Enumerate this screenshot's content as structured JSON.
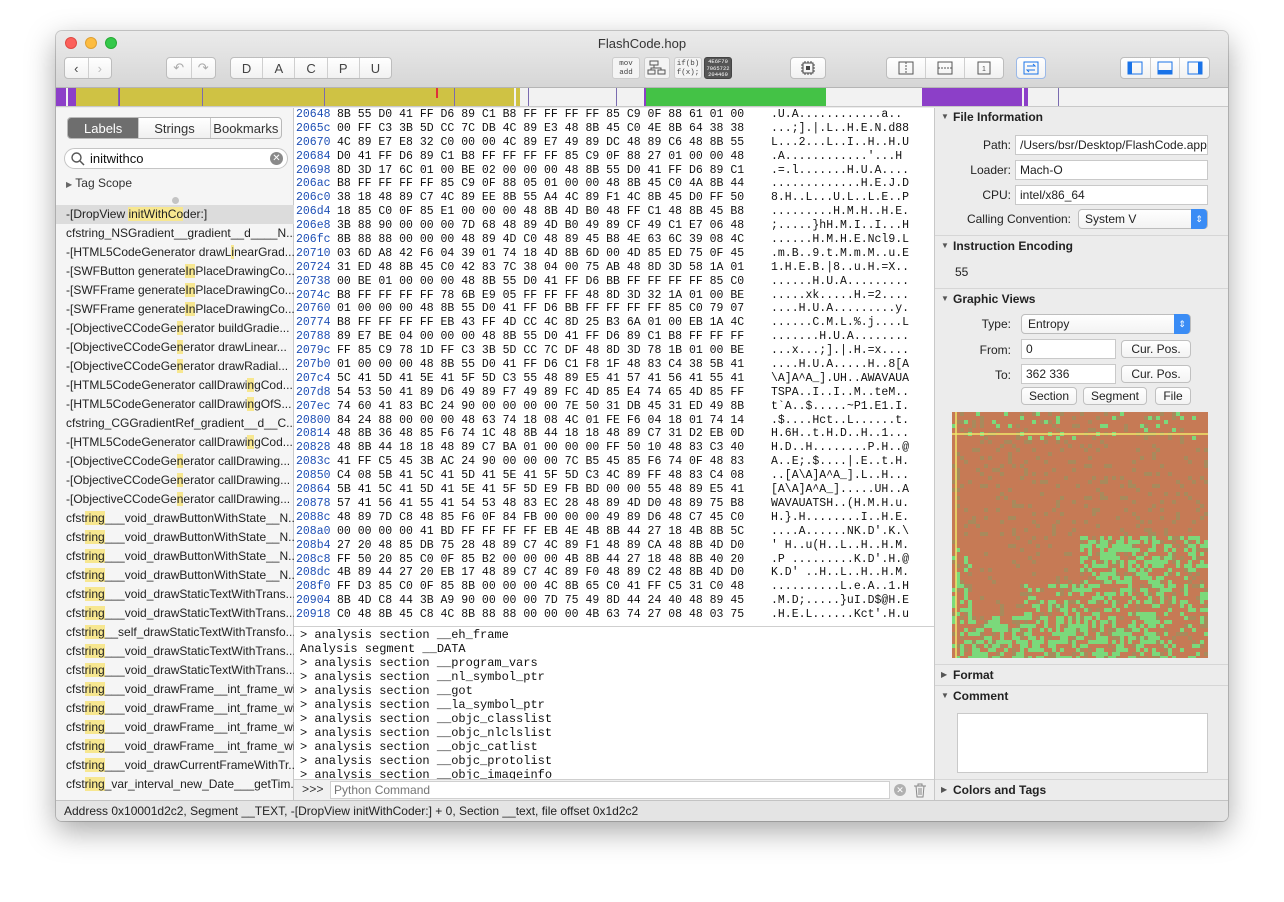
{
  "window": {
    "title": "FlashCode.hop"
  },
  "toolbar": {
    "mode_buttons": [
      "D",
      "A",
      "C",
      "P",
      "U"
    ],
    "asm_icon_text": [
      "mov",
      "add"
    ],
    "pseudo_icon_text": [
      "if(b)",
      "f(x);"
    ],
    "hex_icon_text": [
      "4E6F70",
      "7065722",
      "204469"
    ]
  },
  "navbar_colors": {
    "code": "#cfc244",
    "procedure": "#8c3fc8",
    "data": "#44c246",
    "empty": "#f2f2f2",
    "cursor": "#e0303a"
  },
  "sidebar": {
    "tabs": [
      "Labels",
      "Strings",
      "Bookmarks"
    ],
    "active_tab": "Labels",
    "search_value": "initwithco",
    "tag_scope": "Tag Scope",
    "labels": [
      {
        "pre": "-[DropView ",
        "hl": "initWithCo",
        "post": "der:]"
      },
      {
        "pre": "cfstring_NSGradient__gradient__d",
        "hl": "",
        "post": "____N..."
      },
      {
        "pre": "-[HTML5CodeGenerator drawL",
        "hl": "i",
        "post": "nearGrad..."
      },
      {
        "pre": "-[SWFButton generate",
        "hl": "In",
        "post": "PlaceDrawingCo..."
      },
      {
        "pre": "-[SWFFrame generate",
        "hl": "In",
        "post": "PlaceDrawingCo..."
      },
      {
        "pre": "-[SWFFrame generate",
        "hl": "In",
        "post": "PlaceDrawingCo..."
      },
      {
        "pre": "-[ObjectiveCCodeGe",
        "hl": "n",
        "post": "erator buildGradie..."
      },
      {
        "pre": "-[ObjectiveCCodeGe",
        "hl": "n",
        "post": "erator drawLinear..."
      },
      {
        "pre": "-[ObjectiveCCodeGe",
        "hl": "n",
        "post": "erator drawRadial..."
      },
      {
        "pre": "-[HTML5CodeGenerator callDrawi",
        "hl": "n",
        "post": "gCod..."
      },
      {
        "pre": "-[HTML5CodeGenerator callDrawi",
        "hl": "n",
        "post": "gOfS..."
      },
      {
        "pre": "cfstring_CGGradientRef_gradient__d",
        "hl": "",
        "post": "__C..."
      },
      {
        "pre": "-[HTML5CodeGenerator callDrawi",
        "hl": "n",
        "post": "gCod..."
      },
      {
        "pre": "-[ObjectiveCCodeGe",
        "hl": "n",
        "post": "erator callDrawing..."
      },
      {
        "pre": "-[ObjectiveCCodeGe",
        "hl": "n",
        "post": "erator callDrawing..."
      },
      {
        "pre": "-[ObjectiveCCodeGe",
        "hl": "n",
        "post": "erator callDrawing..."
      },
      {
        "pre": "cfst",
        "hl": "ring",
        "post": "___void_drawButtonWithState__N..."
      },
      {
        "pre": "cfst",
        "hl": "ring",
        "post": "___void_drawButtonWithState__N..."
      },
      {
        "pre": "cfst",
        "hl": "ring",
        "post": "___void_drawButtonWithState__N..."
      },
      {
        "pre": "cfst",
        "hl": "ring",
        "post": "___void_drawButtonWithState__N..."
      },
      {
        "pre": "cfst",
        "hl": "ring",
        "post": "___void_drawStaticTextWithTrans..."
      },
      {
        "pre": "cfst",
        "hl": "ring",
        "post": "___void_drawStaticTextWithTrans..."
      },
      {
        "pre": "cfst",
        "hl": "ring",
        "post": "__self_drawStaticTextWithTransfo..."
      },
      {
        "pre": "cfst",
        "hl": "ring",
        "post": "___void_drawStaticTextWithTrans..."
      },
      {
        "pre": "cfst",
        "hl": "ring",
        "post": "___void_drawStaticTextWithTrans..."
      },
      {
        "pre": "cfst",
        "hl": "ring",
        "post": "___void_drawFrame__int_frame_wi..."
      },
      {
        "pre": "cfst",
        "hl": "ring",
        "post": "___void_drawFrame__int_frame_wi..."
      },
      {
        "pre": "cfst",
        "hl": "ring",
        "post": "___void_drawFrame__int_frame_wi..."
      },
      {
        "pre": "cfst",
        "hl": "ring",
        "post": "___void_drawFrame__int_frame_wi..."
      },
      {
        "pre": "cfst",
        "hl": "ring",
        "post": "___void_drawCurrentFrameWithTr..."
      },
      {
        "pre": "cfst",
        "hl": "ring",
        "post": "_var_interval_new_Date___getTim..."
      }
    ]
  },
  "hex": {
    "rows": [
      {
        "addr": "20648",
        "bytes": "8B 55 D0 41 FF D6 89 C1 B8 FF FF FF FF 85 C9 0F 88 61 01 00",
        "ascii": ".U.A............a.."
      },
      {
        "addr": "2065c",
        "bytes": "00 FF C3 3B 5D CC 7C DB 4C 89 E3 48 8B 45 C0 4E 8B 64 38 38",
        "ascii": "...;].|.L..H.E.N.d88"
      },
      {
        "addr": "20670",
        "bytes": "4C 89 E7 E8 32 C0 00 00 4C 89 E7 49 89 DC 48 89 C6 48 8B 55",
        "ascii": "L...2...L..I..H..H.U"
      },
      {
        "addr": "20684",
        "bytes": "D0 41 FF D6 89 C1 B8 FF FF FF FF 85 C9 0F 88 27 01 00 00 48",
        "ascii": ".A............'...H"
      },
      {
        "addr": "20698",
        "bytes": "8D 3D 17 6C 01 00 BE 02 00 00 00 48 8B 55 D0 41 FF D6 89 C1",
        "ascii": ".=.l.......H.U.A...."
      },
      {
        "addr": "206ac",
        "bytes": "B8 FF FF FF FF 85 C9 0F 88 05 01 00 00 48 8B 45 C0 4A 8B 44",
        "ascii": ".............H.E.J.D"
      },
      {
        "addr": "206c0",
        "bytes": "38 18 48 89 C7 4C 89 EE 8B 55 A4 4C 89 F1 4C 8B 45 D0 FF 50",
        "ascii": "8.H..L...U.L..L.E..P"
      },
      {
        "addr": "206d4",
        "bytes": "18 85 C0 0F 85 E1 00 00 00 48 8B 4D B0 48 FF C1 48 8B 45 B8",
        "ascii": ".........H.M.H..H.E."
      },
      {
        "addr": "206e8",
        "bytes": "3B 88 90 00 00 00 7D 68 48 89 4D B0 49 89 CF 49 C1 E7 06 48",
        "ascii": ";.....}hH.M.I..I...H"
      },
      {
        "addr": "206fc",
        "bytes": "8B 88 88 00 00 00 48 89 4D C0 48 89 45 B8 4E 63 6C 39 08 4C",
        "ascii": "......H.M.H.E.Ncl9.L"
      },
      {
        "addr": "20710",
        "bytes": "03 6D A8 42 F6 04 39 01 74 18 4D 8B 6D 00 4D 85 ED 75 0F 45",
        "ascii": ".m.B..9.t.M.m.M..u.E"
      },
      {
        "addr": "20724",
        "bytes": "31 ED 48 8B 45 C0 42 83 7C 38 04 00 75 AB 48 8D 3D 58 1A 01",
        "ascii": "1.H.E.B.|8..u.H.=X.."
      },
      {
        "addr": "20738",
        "bytes": "00 BE 01 00 00 00 48 8B 55 D0 41 FF D6 BB FF FF FF FF 85 C0",
        "ascii": "......H.U.A........."
      },
      {
        "addr": "2074c",
        "bytes": "B8 FF FF FF FF 78 6B E9 05 FF FF FF 48 8D 3D 32 1A 01 00 BE",
        "ascii": ".....xk.....H.=2...."
      },
      {
        "addr": "20760",
        "bytes": "01 00 00 00 48 8B 55 D0 41 FF D6 BB FF FF FF FF 85 C0 79 07",
        "ascii": "....H.U.A.........y."
      },
      {
        "addr": "20774",
        "bytes": "B8 FF FF FF FF EB 43 FF 4D CC 4C 8D 25 B3 6A 01 00 EB 1A 4C",
        "ascii": "......C.M.L.%.j....L"
      },
      {
        "addr": "20788",
        "bytes": "89 E7 BE 04 00 00 00 48 8B 55 D0 41 FF D6 89 C1 B8 FF FF FF",
        "ascii": ".......H.U.A........"
      },
      {
        "addr": "2079c",
        "bytes": "FF 85 C9 78 1D FF C3 3B 5D CC 7C DF 48 8D 3D 78 1B 01 00 BE",
        "ascii": "...x...;].|.H.=x...."
      },
      {
        "addr": "207b0",
        "bytes": "01 00 00 00 48 8B 55 D0 41 FF D6 C1 F8 1F 48 83 C4 38 5B 41",
        "ascii": "....H.U.A.....H..8[A"
      },
      {
        "addr": "207c4",
        "bytes": "5C 41 5D 41 5E 41 5F 5D C3 55 48 89 E5 41 57 41 56 41 55 41",
        "ascii": "\\A]A^A_].UH..AWAVAUA"
      },
      {
        "addr": "207d8",
        "bytes": "54 53 50 41 89 D6 49 89 F7 49 89 FC 4D 85 E4 74 65 4D 85 FF",
        "ascii": "TSPA..I..I..M..teM.."
      },
      {
        "addr": "207ec",
        "bytes": "74 60 41 83 BC 24 90 00 00 00 00 7E 50 31 DB 45 31 ED 49 8B",
        "ascii": "t`A..$.....~P1.E1.I."
      },
      {
        "addr": "20800",
        "bytes": "84 24 88 00 00 00 48 63 74 18 08 4C 01 FE F6 04 18 01 74 14",
        "ascii": ".$....Hct..L......t."
      },
      {
        "addr": "20814",
        "bytes": "48 8B 36 48 85 F6 74 1C 48 8B 44 18 18 48 89 C7 31 D2 EB 0D",
        "ascii": "H.6H..t.H.D..H..1..."
      },
      {
        "addr": "20828",
        "bytes": "48 8B 44 18 18 48 89 C7 BA 01 00 00 00 FF 50 10 48 83 C3 40",
        "ascii": "H.D..H........P.H..@"
      },
      {
        "addr": "2083c",
        "bytes": "41 FF C5 45 3B AC 24 90 00 00 00 7C B5 45 85 F6 74 0F 48 83",
        "ascii": "A..E;.$....|.E..t.H."
      },
      {
        "addr": "20850",
        "bytes": "C4 08 5B 41 5C 41 5D 41 5E 41 5F 5D C3 4C 89 FF 48 83 C4 08",
        "ascii": "..[A\\A]A^A_].L..H..."
      },
      {
        "addr": "20864",
        "bytes": "5B 41 5C 41 5D 41 5E 41 5F 5D E9 FB BD 00 00 55 48 89 E5 41",
        "ascii": "[A\\A]A^A_].....UH..A"
      },
      {
        "addr": "20878",
        "bytes": "57 41 56 41 55 41 54 53 48 83 EC 28 48 89 4D D0 48 89 75 B8",
        "ascii": "WAVAUATSH..(H.M.H.u."
      },
      {
        "addr": "2088c",
        "bytes": "48 89 7D C8 48 85 F6 0F 84 FB 00 00 00 49 89 D6 48 C7 45 C0",
        "ascii": "H.}.H........I..H.E."
      },
      {
        "addr": "208a0",
        "bytes": "00 00 00 00 41 BD FF FF FF FF EB 4E 4B 8B 44 27 18 4B 8B 5C",
        "ascii": "....A......NK.D'.K.\\"
      },
      {
        "addr": "208b4",
        "bytes": "27 20 48 85 DB 75 28 48 89 C7 4C 89 F1 48 89 CA 48 8B 4D D0",
        "ascii": "' H..u(H..L..H..H.M."
      },
      {
        "addr": "208c8",
        "bytes": "FF 50 20 85 C0 0F 85 B2 00 00 00 4B 8B 44 27 18 48 8B 40 20",
        "ascii": ".P .........K.D'.H.@ "
      },
      {
        "addr": "208dc",
        "bytes": "4B 89 44 27 20 EB 17 48 89 C7 4C 89 F0 48 89 C2 48 8B 4D D0",
        "ascii": "K.D' ..H..L..H..H.M."
      },
      {
        "addr": "208f0",
        "bytes": "FF D3 85 C0 0F 85 8B 00 00 00 4C 8B 65 C0 41 FF C5 31 C0 48",
        "ascii": "..........L.e.A..1.H"
      },
      {
        "addr": "20904",
        "bytes": "8B 4D C8 44 3B A9 90 00 00 00 7D 75 49 8D 44 24 40 48 89 45",
        "ascii": ".M.D;.....}uI.D$@H.E"
      },
      {
        "addr": "20918",
        "bytes": "C0 48 8B 45 C8 4C 8B 88 88 00 00 00 4B 63 74 27 08 48 03 75",
        "ascii": ".H.E.L......Kct'.H.u"
      }
    ]
  },
  "console": {
    "lines": [
      "> analysis section __eh_frame",
      "Analysis segment __DATA",
      "> analysis section __program_vars",
      "> analysis section __nl_symbol_ptr",
      "> analysis section __got",
      "> analysis section __la_symbol_ptr",
      "> analysis section __objc_classlist",
      "> analysis section __objc_nlclslist",
      "> analysis section __objc_catlist",
      "> analysis section __objc_protolist",
      "> analysis section __objc_imageinfo"
    ],
    "prompt": ">>>",
    "placeholder": "Python Command"
  },
  "status_bar": {
    "text": "Address 0x10001d2c2, Segment __TEXT, -[DropView initWithCoder:] + 0, Section __text, file offset 0x1d2c2"
  },
  "inspector": {
    "file_info": {
      "header": "File Information",
      "path_label": "Path:",
      "path": "/Users/bsr/Desktop/FlashCode.app/",
      "loader_label": "Loader:",
      "loader": "Mach-O",
      "cpu_label": "CPU:",
      "cpu": "intel/x86_64",
      "calling_label": "Calling Convention:",
      "calling": "System V"
    },
    "instruction_encoding": {
      "header": "Instruction Encoding",
      "value": "55"
    },
    "graphic_views": {
      "header": "Graphic Views",
      "type_label": "Type:",
      "type": "Entropy",
      "from_label": "From:",
      "from": "0",
      "to_label": "To:",
      "to": "362 336",
      "cur_pos": "Cur. Pos.",
      "section_btn": "Section",
      "segment_btn": "Segment",
      "file_btn": "File",
      "entropy_colors": {
        "high": "#c67a55",
        "mid": "#a88a5c",
        "low": "#7bd97b",
        "marker": "#f0e86a"
      }
    },
    "format": {
      "header": "Format"
    },
    "comment": {
      "header": "Comment"
    },
    "colors_tags": {
      "header": "Colors and Tags"
    }
  }
}
